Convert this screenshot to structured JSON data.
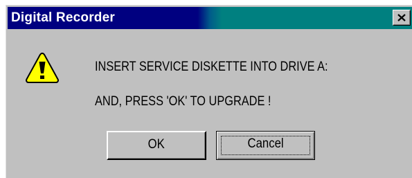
{
  "window": {
    "title": "Digital Recorder",
    "close_icon": "close-icon"
  },
  "message": {
    "line1": "INSERT SERVICE DISKETTE INTO DRIVE A:",
    "line2": "AND, PRESS 'OK' TO UPGRADE !",
    "icon": "warning-icon"
  },
  "buttons": {
    "ok_label": "OK",
    "cancel_label": "Cancel"
  },
  "colors": {
    "titlebar_active": "#000080",
    "titlebar_gradient_end": "#008080",
    "dialog_face": "#c0c0c0",
    "warning_fill": "#ffff00"
  }
}
